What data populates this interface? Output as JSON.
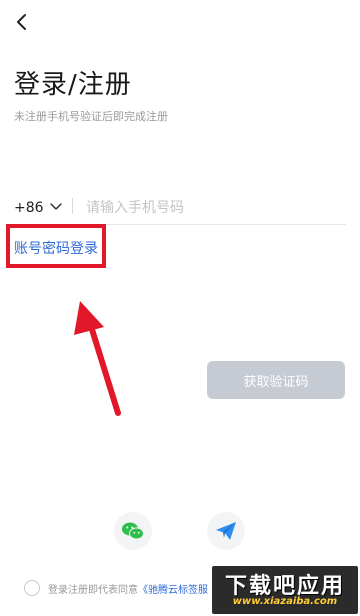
{
  "header": {
    "back_icon": "chevron-left-icon"
  },
  "title": "登录/注册",
  "subtitle": "未注册手机号验证后即完成注册",
  "phone": {
    "country_code": "+86",
    "dropdown_icon": "chevron-down-icon",
    "placeholder": "请输入手机号码",
    "value": ""
  },
  "account_login_label": "账号密码登录",
  "annotation": {
    "color": "#e2182a"
  },
  "get_code_label": "获取验证码",
  "social": [
    {
      "icon": "wechat-icon",
      "color": "#2dbf4a"
    },
    {
      "icon": "telegram-icon",
      "color": "#2c8ef0"
    }
  ],
  "agreement": {
    "prefix": "登录注册即代表同意",
    "link": "《驰腾云标签服"
  },
  "watermark": {
    "main": "下载吧应用",
    "url": "www.xiazaiba.com"
  },
  "colors": {
    "link": "#2f6bd8",
    "button_disabled": "#c5cad3"
  }
}
